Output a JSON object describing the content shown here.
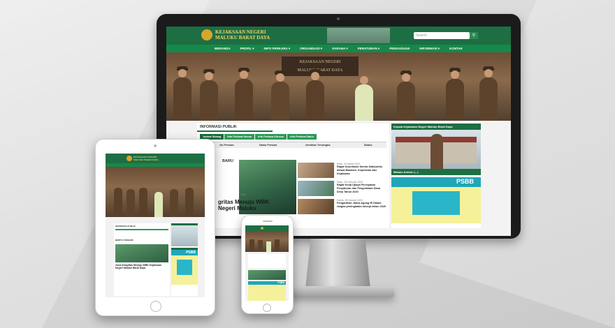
{
  "site": {
    "title_line1": "KEJAKSAAN NEGERI",
    "title_line2": "MALUKU BARAT DAYA",
    "search_placeholder": "Search",
    "nav": [
      "BERANDA",
      "PROFIL ▾",
      "INFO PERKARA ▾",
      "ORGANISASI ▾",
      "SARANA ▾",
      "PERATURAN ▾",
      "PENGADUAN",
      "INFORMASI ▾",
      "KONTAK"
    ],
    "hero_sign_line1": "KEJAKSAAN NEGERI",
    "hero_sign_line2": "MALUKU BARAT DAYA",
    "info_title": "INFORMASI PUBLIK",
    "tabs": [
      "Jadwal Sidang",
      "Info Perkara Umum",
      "Info Perkara Khusus",
      "Info Perkara Datun"
    ],
    "table_headers": [
      "No.",
      "No Perkara",
      "Nama Perkara",
      "Identitas Tersangka",
      "Status"
    ],
    "berita_title": "BARU",
    "headline_line1": "gritas Menuju WBK",
    "headline_line2": "Negeri Maluku",
    "headline_meta": "Oleh",
    "news": [
      {
        "date": "Rabu, 04 Maret 2020",
        "title": "Rapat Koordinasi Sentra Gakkumdu antara Bawaslu, Kepolisian dan Kejaksaan"
      },
      {
        "date": "Rabu, 26 Februari 2020",
        "title": "Rapat Kerja Upaya Percepatan Penyaluran dan Pengelolaan Dana Desa Tahun 2020"
      },
      {
        "date": "Kamis, 30 Januari 2020",
        "title": "Pengarahan Jaksa Agung RI Dalam rangka peningkatan kinerja tahun 2020"
      }
    ],
    "side_head": "Kepala Kejaksaan Negeri Maluku Barat Daya",
    "side_head2": "Maluku Ambon (...)",
    "psbb_label": "PSBB"
  },
  "ipad": {
    "info_title": "INFORMASI PUBLIK",
    "berita_title": "BERITA TERBARU",
    "headline": "Zona Integritas Menuju WBK Kejaksaan Negeri Maluku Barat Daya",
    "psbb_label": "PSBB"
  },
  "iphone": {
    "psbb_label": "PSBB"
  },
  "colors": {
    "brand_green": "#1e6e43",
    "nav_green": "#15894a",
    "gold": "#f2d46b"
  }
}
